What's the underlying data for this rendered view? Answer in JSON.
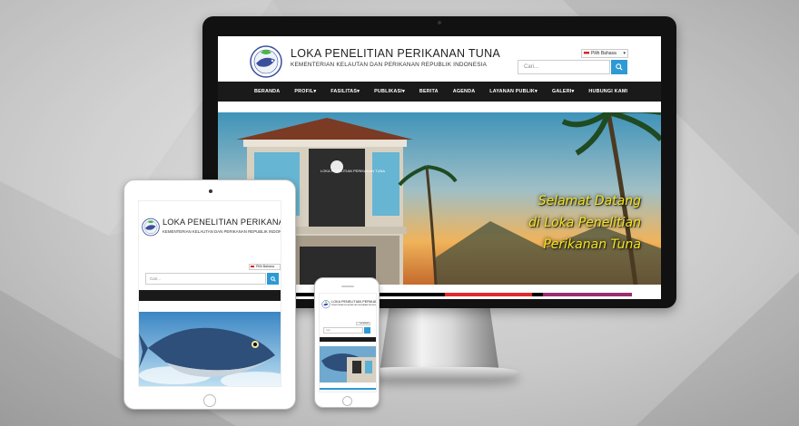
{
  "site": {
    "title": "LOKA PENELITIAN PERIKANAN TUNA",
    "subtitle": "KEMENTERIAN KELAUTAN DAN PERIKANAN REPUBLIK INDONESIA",
    "language_selector": "Pilih Bahasa",
    "search_placeholder": "Cari...",
    "nav": [
      "BERANDA",
      "PROFIL▾",
      "FASILITAS▾",
      "PUBLIKASI▾",
      "BERITA",
      "AGENDA",
      "LAYANAN PUBLIK▾",
      "GALERI▾",
      "HUBUNGI KAMI"
    ],
    "hero_lines": [
      "Selamat Datang",
      "di Loka Penelitian",
      "Perikanan Tuna"
    ],
    "building_sign": "LOKA PENELITIAN PERIKANAN TUNA"
  },
  "colors": {
    "nav_bg": "#1a1a1a",
    "accent_blue": "#2e9ad3",
    "hero_text": "#f4e41c",
    "bar_colors": [
      "#e68a1f",
      "#e02a2a",
      "#9b2d6f"
    ]
  },
  "icons": {
    "search": "search-icon",
    "logo": "tuna-logo-icon",
    "flag": "flag-icon"
  }
}
